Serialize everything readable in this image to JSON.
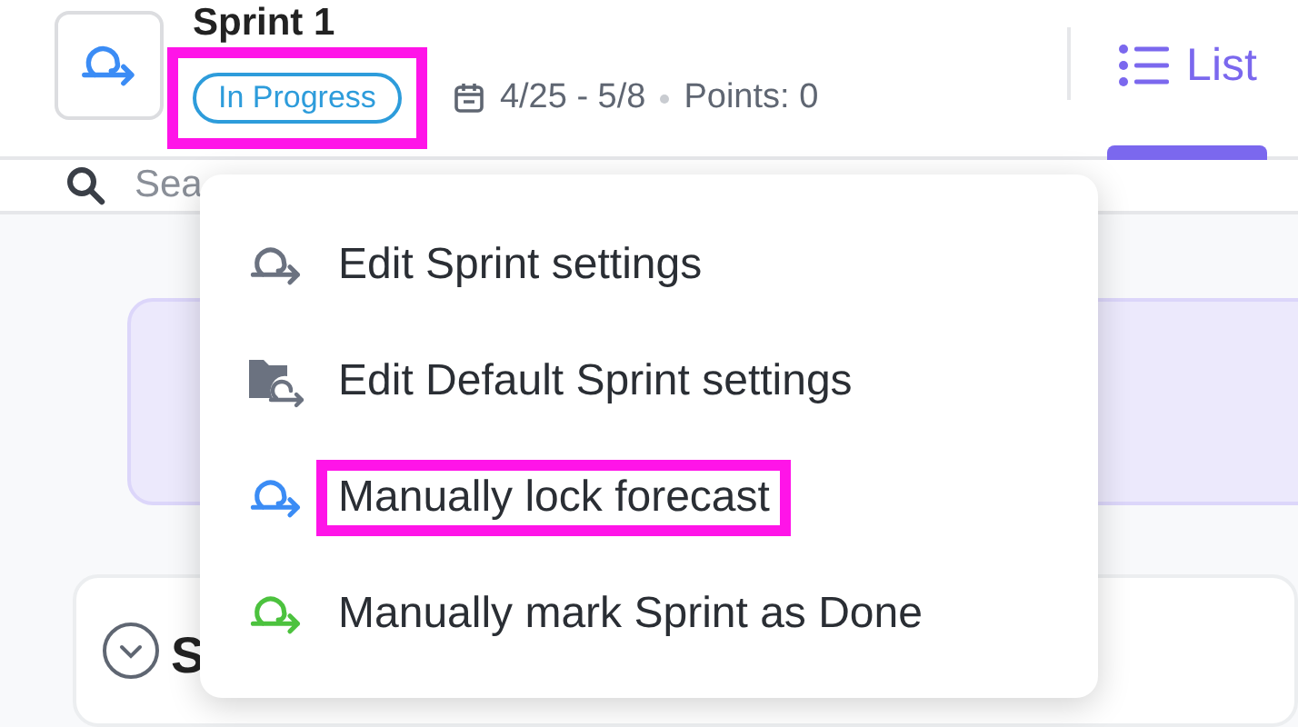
{
  "header": {
    "title": "Sprint 1",
    "status": {
      "label": "In Progress",
      "highlighted": true
    },
    "dates": "4/25 - 5/8",
    "points": "Points: 0",
    "tabs": [
      {
        "label": "List",
        "selected": true
      }
    ]
  },
  "search": {
    "placeholder": "Sea"
  },
  "section": {
    "title": "S"
  },
  "menu": {
    "items": [
      {
        "label": "Edit Sprint settings",
        "kind": "sprint",
        "color": "#6b7280",
        "highlighted": false
      },
      {
        "label": "Edit Default Sprint settings",
        "kind": "folder",
        "color": "#6b7280",
        "highlighted": false
      },
      {
        "label": "Manually lock forecast",
        "kind": "sprint",
        "color": "#3b8cf5",
        "highlighted": true
      },
      {
        "label": "Manually mark Sprint as Done",
        "kind": "sprint",
        "color": "#4cc23e",
        "highlighted": false
      }
    ]
  }
}
